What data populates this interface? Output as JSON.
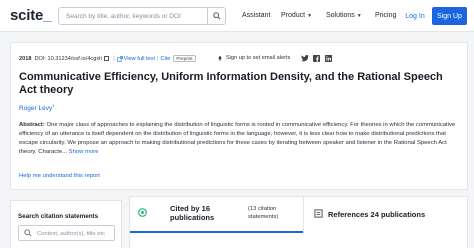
{
  "header": {
    "logo_text": "scite",
    "logo_mark": "_",
    "search_placeholder": "Search by title, author, keywords or DOI",
    "nav": {
      "assistant": "Assistant",
      "product": "Product",
      "solutions": "Solutions",
      "pricing": "Pricing"
    },
    "login_label": "Log In",
    "signup_label": "Sign Up"
  },
  "paper": {
    "year": "2018",
    "doi": "DOI: 10.31234/osf.io/4cgxh",
    "view_full_text": "View full text",
    "cite": "Cite",
    "badge": "Preprint",
    "alert": "Sign up to set email alerts",
    "title": "Communicative Efficiency, Uniform Information Density, and the Rational Speech Act theory",
    "author": "Roger Lévy",
    "author_sup": "1",
    "abstract_label": "Abstract:",
    "abstract_text": " One major class of approaches to explaining the distribution of linguistic forms is rooted in communicative efficiency. For theories in which the communicative efficiency of an utterance is itself dependent on the distribution of linguistic forms in the language, however, it is less clear how to make distributional predictions that escape circularity. We propose an approach to making distributional predictions for these cases by iterating between speaker and listener in the Rational Speech Act theory. Characte...",
    "show_more": "Show more",
    "help_link": "Help me understand this report"
  },
  "citations_panel": {
    "title": "Search citation statements",
    "placeholder": "Context, author(s), title etc"
  },
  "tabs": {
    "cited_by": "Cited by 16 publications",
    "cited_sub": "(13 citation statements)",
    "references": "References 24 publications"
  },
  "colors": {
    "accent": "#1a66e0",
    "cited_icon": "#2bb673"
  }
}
